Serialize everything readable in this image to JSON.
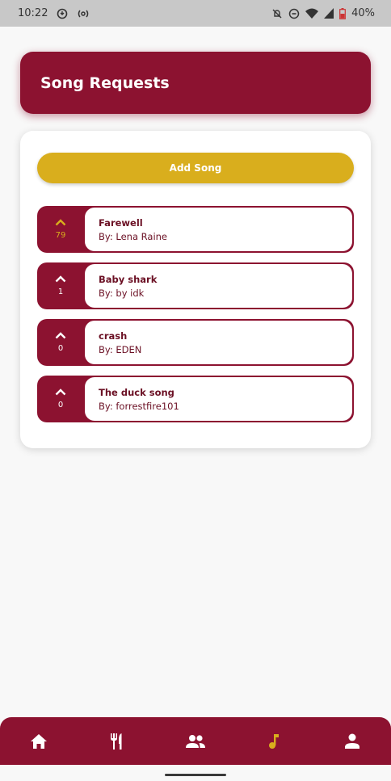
{
  "status_bar": {
    "time": "10:22",
    "battery": "40%",
    "icons": [
      "sync-icon",
      "cast-icon",
      "mute-icon",
      "dnd-icon",
      "wifi-icon",
      "signal-icon",
      "battery-icon"
    ]
  },
  "header": {
    "title": "Song Requests"
  },
  "add_song": {
    "label": "Add Song"
  },
  "songs": [
    {
      "title": "Farewell",
      "artist": "By: Lena Raine",
      "votes": "79",
      "upvoted": true
    },
    {
      "title": "Baby shark",
      "artist": "By: by idk",
      "votes": "1",
      "upvoted": false
    },
    {
      "title": "crash",
      "artist": "By: EDEN",
      "votes": "0",
      "upvoted": false
    },
    {
      "title": "The duck song",
      "artist": "By: forrestfire101",
      "votes": "0",
      "upvoted": false
    }
  ],
  "nav": {
    "items": [
      "home-icon",
      "restaurant-icon",
      "people-icon",
      "music-note-icon",
      "person-icon"
    ],
    "active": "music-note-icon"
  },
  "colors": {
    "primary": "#8c1230",
    "accent": "#d9ae1d",
    "background": "#f8f8f8",
    "status_bar": "#c8c8c8"
  }
}
